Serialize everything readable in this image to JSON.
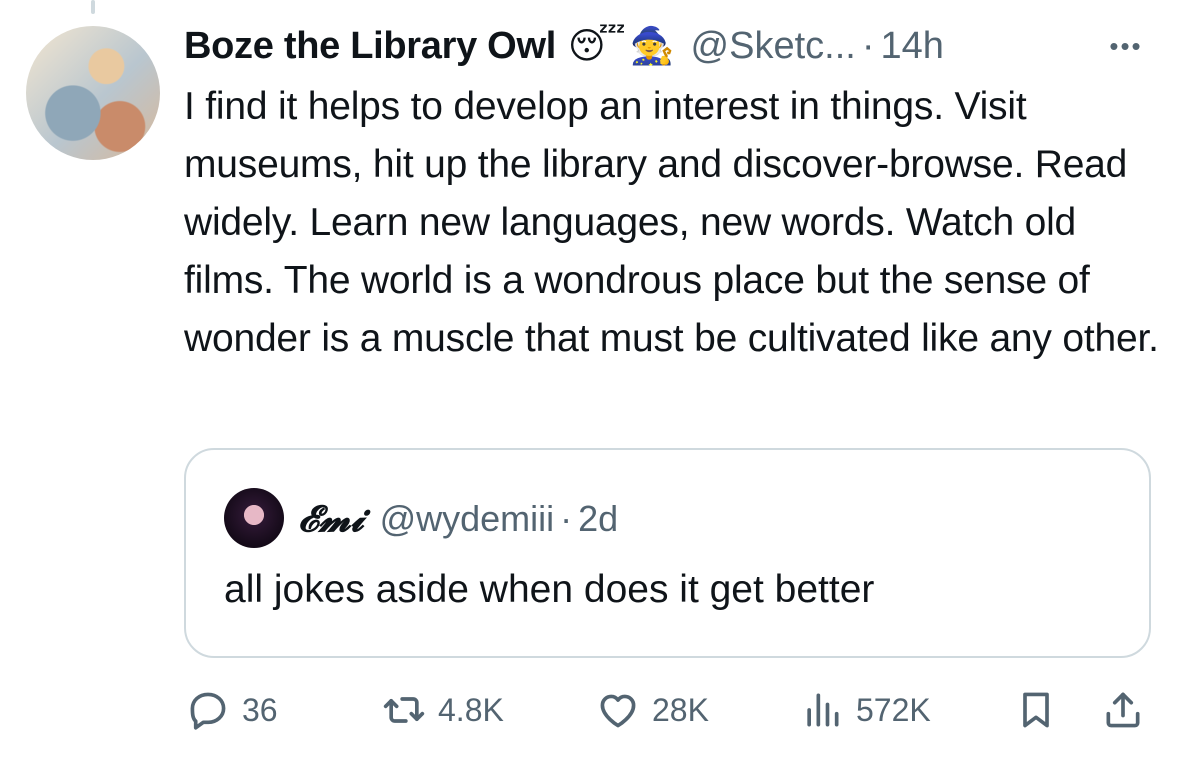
{
  "tweet": {
    "display_name": "Boze the Library Owl",
    "emoji_1": "😴",
    "emoji_2": "🧙",
    "handle": "@Sketc...",
    "separator": "·",
    "time": "14h",
    "more_label": "•••",
    "text": "I find it helps to develop an interest in things. Visit museums, hit up the library and discover-browse. Read widely. Learn new languages, new words. Watch old films. The world is a wondrous place but the sense of wonder is a muscle that must be cultivated like any other."
  },
  "quoted": {
    "display_name": "𝓔𝓶𝓲",
    "handle": "@wydemiii",
    "separator": "·",
    "time": "2d",
    "text": "all jokes aside when does it get better"
  },
  "actions": {
    "replies": "36",
    "retweets": "4.8K",
    "likes": "28K",
    "views": "572K"
  },
  "colors": {
    "text": "#0f1419",
    "muted": "#536471",
    "border": "#cfd9de"
  }
}
